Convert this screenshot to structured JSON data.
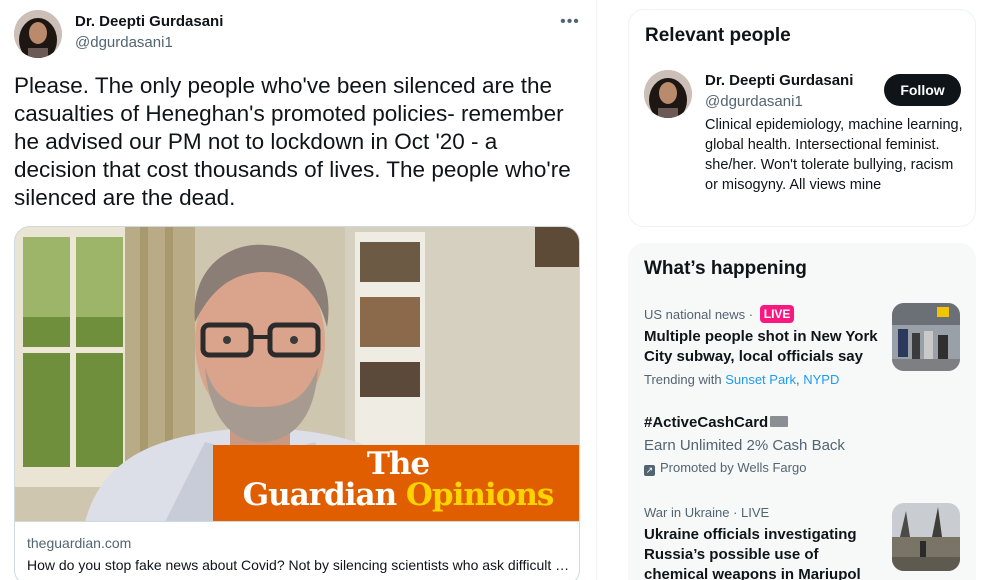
{
  "tweet": {
    "author_name": "Dr. Deepti Gurdasani",
    "author_handle": "@dgurdasani1",
    "more_icon": "more-horizontal-icon",
    "text": "Please. The only people who've been silenced are the casualties of Heneghan's promoted policies- remember he advised our PM not to lockdown in Oct '20 - a decision that cost thousands of lives. The people who're silenced are the dead.",
    "card": {
      "image_wordmark_line1": "The",
      "image_wordmark_line2": "Guardian",
      "image_wordmark_opinions": "Opinions",
      "domain": "theguardian.com",
      "title": "How do you stop fake news about Covid? Not by silencing scientists who ask difficult questions"
    }
  },
  "relevant_people": {
    "title": "Relevant people",
    "person": {
      "name": "Dr. Deepti Gurdasani",
      "handle": "@dgurdasani1",
      "follow_label": "Follow",
      "bio": "Clinical epidemiology, machine learning, global health. Intersectional feminist. she/her. Won't tolerate bullying, racism or misogyny. All views mine"
    }
  },
  "whats_happening": {
    "title": "What’s happening",
    "trends": [
      {
        "meta": "US national news ·",
        "badge": "LIVE",
        "title": "Multiple people shot in New York City subway, local officials say",
        "trending_prefix": "Trending with",
        "trending_links": [
          "Sunset Park",
          "NYPD"
        ]
      },
      {
        "title": "#ActiveCashCard",
        "subtitle": "Earn Unlimited 2% Cash Back",
        "promoted": "Promoted by Wells Fargo"
      },
      {
        "meta": "War in Ukraine · LIVE",
        "title": "Ukraine officials investigating Russia’s possible use of chemical weapons in Mariupol"
      }
    ]
  },
  "colors": {
    "text_primary": "#0f1419",
    "text_secondary": "#536471",
    "link": "#1d9bf0",
    "live_badge": "#f91880",
    "guardian_orange": "#e05e00",
    "guardian_yellow": "#ffd300"
  }
}
